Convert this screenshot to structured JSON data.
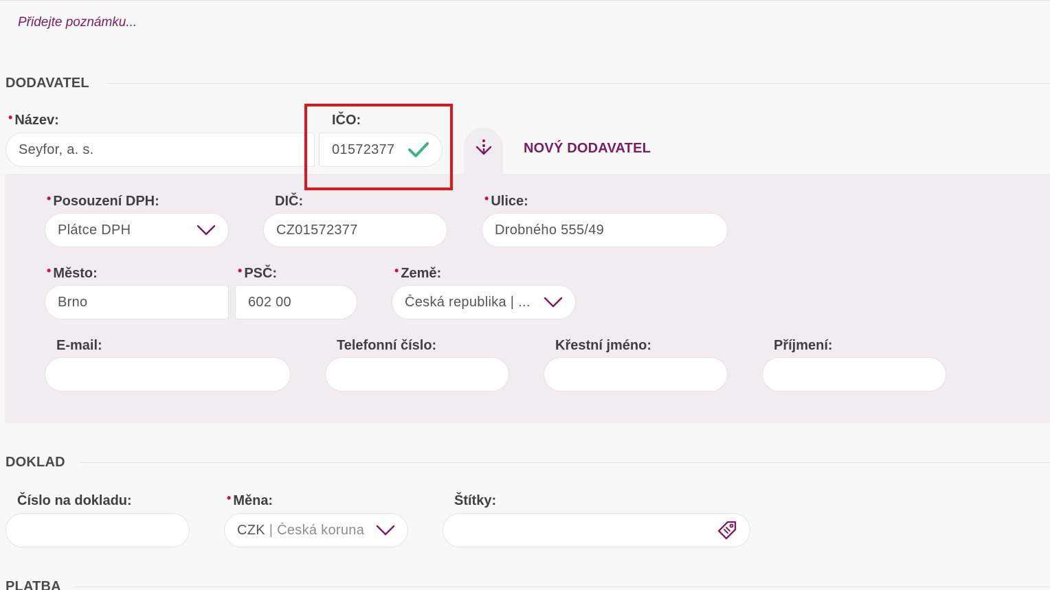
{
  "note_placeholder": "Přidejte poznámku...",
  "supplier": {
    "section_title": "DODAVATEL",
    "name_label": "Název:",
    "name_value": "Seyfor, a. s.",
    "ico_label": "IČO:",
    "ico_value": "01572377",
    "new_supplier_label": "NOVÝ DODAVATEL",
    "vat_label": "Posouzení DPH:",
    "vat_value": "Plátce DPH",
    "dic_label": "DIČ:",
    "dic_value": "CZ01572377",
    "street_label": "Ulice:",
    "street_value": "Drobného 555/49",
    "city_label": "Město:",
    "city_value": "Brno",
    "zip_label": "PSČ:",
    "zip_value": "602 00",
    "country_label": "Země:",
    "country_value": "Česká republika | ...",
    "email_label": "E-mail:",
    "phone_label": "Telefonní číslo:",
    "firstname_label": "Křestní jméno:",
    "lastname_label": "Příjmení:"
  },
  "document": {
    "section_title": "DOKLAD",
    "doc_number_label": "Číslo na dokladu:",
    "currency_label": "Měna:",
    "currency_code": "CZK",
    "currency_name": "| Česká koruna",
    "tags_label": "Štítky:"
  },
  "payment": {
    "section_title": "PLATBA"
  },
  "colors": {
    "accent": "#7a1d5c",
    "required": "#c4124b",
    "check": "#3fb37f",
    "highlight": "#e0161b"
  },
  "icons": {
    "ico_valid": "check-icon",
    "load_supplier": "arrow-down-dotted-icon",
    "dropdown": "chevron-down-icon",
    "tags": "tag-icon"
  }
}
